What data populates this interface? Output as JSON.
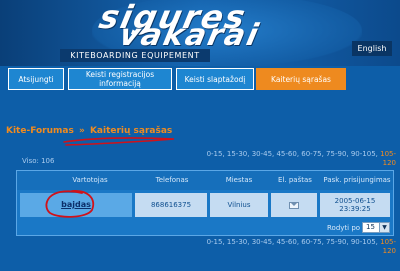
{
  "header": {
    "logo_line1": "sigures",
    "logo_line2": "vakarai",
    "subtitle": "KITEBOARDING EQUIPEMENT",
    "language_link": "English"
  },
  "nav": {
    "tabs": [
      {
        "label": "Atsijungti",
        "active": false
      },
      {
        "label": "Keisti registracijos informaciją",
        "active": false
      },
      {
        "label": "Keisti slaptažodį",
        "active": false
      },
      {
        "label": "Kaiterių sąrašas",
        "active": true
      }
    ]
  },
  "breadcrumb": {
    "root": "Kite-Forumas",
    "separator": "»",
    "current": "Kaiterių sąrašas"
  },
  "list": {
    "total_label": "Viso: 106",
    "pagination_top": "0-15, 15-30, 30-45, 45-60, 60-75, 75-90, 90-105, ",
    "pagination_current": "105-120",
    "pagination_bottom": "0-15, 15-30, 30-45, 45-60, 60-75, 75-90, 90-105, "
  },
  "table": {
    "columns": [
      "Vartotojas",
      "Telefonas",
      "Miestas",
      "El. paštas",
      "Pask. prisijungimas"
    ],
    "rows": [
      {
        "user": "bajdas",
        "phone": "868616375",
        "city": "Vilnius",
        "email_icon": "mail-icon",
        "last_login": "2005-06-15 23:39:25"
      }
    ],
    "per_page_label": "Rodyti po",
    "per_page_value": "15"
  },
  "colors": {
    "background": "#0d5ea8",
    "accent_orange": "#ee8a1f",
    "annotation_red": "#d0121a"
  }
}
